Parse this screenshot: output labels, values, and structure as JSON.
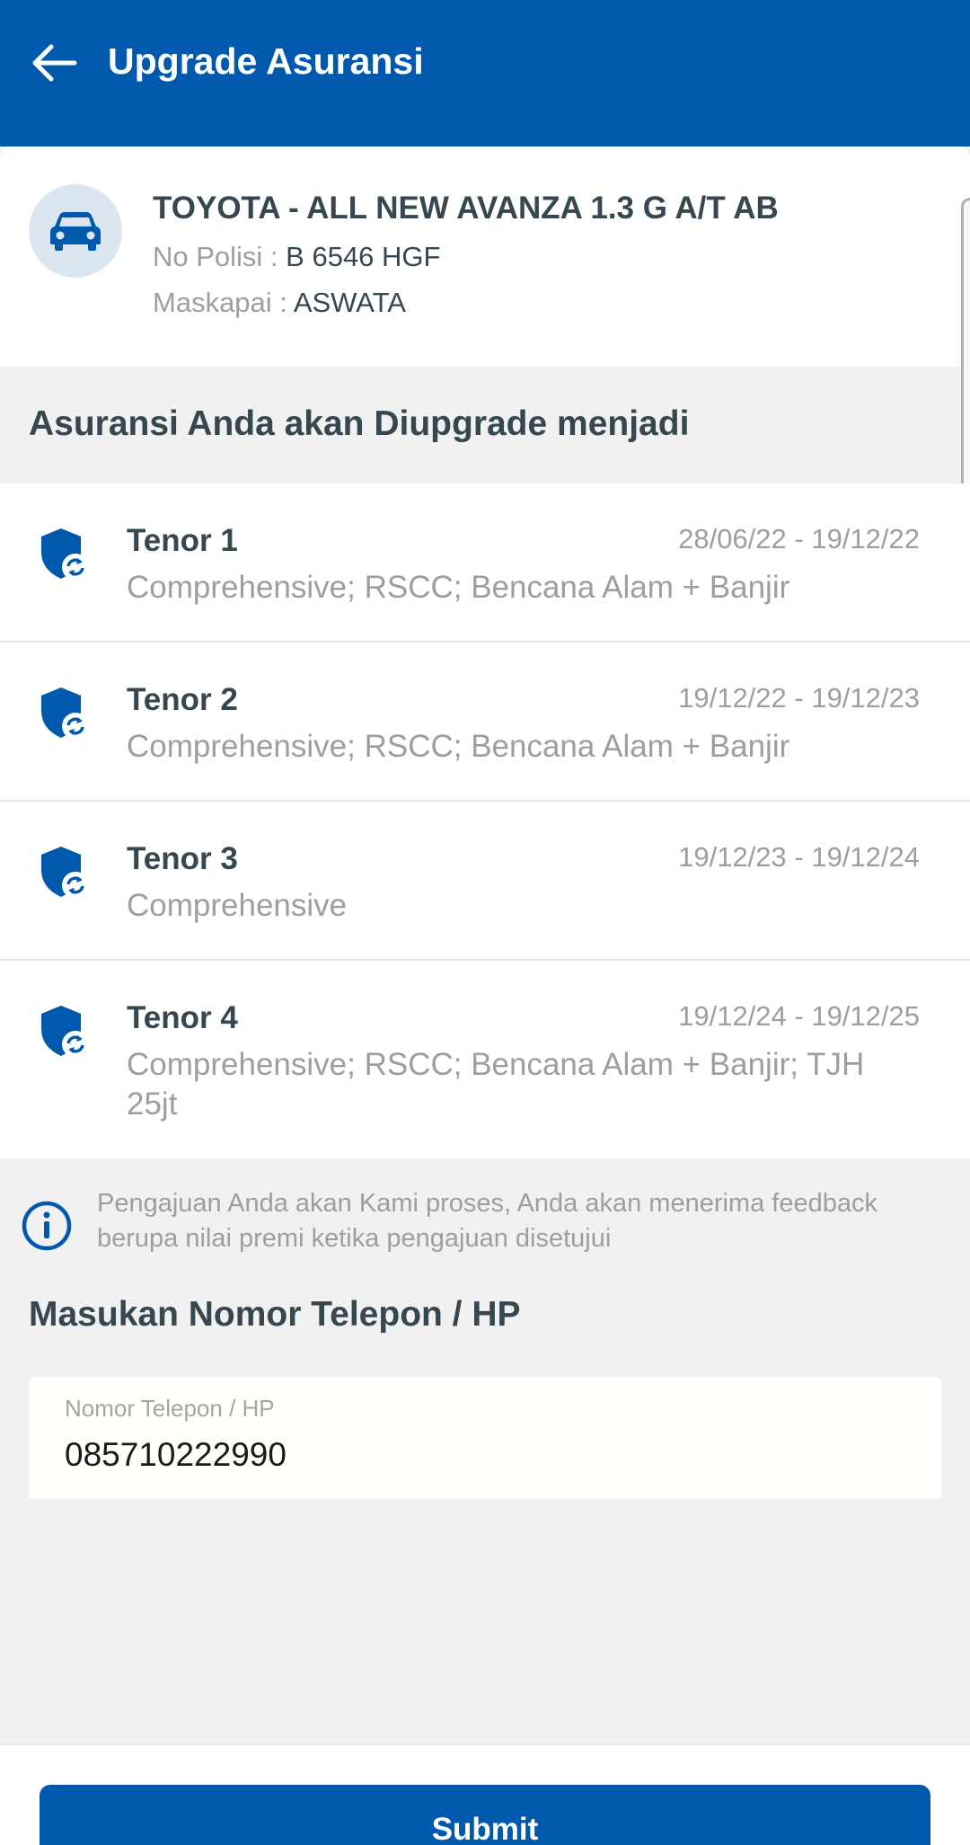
{
  "header": {
    "title": "Upgrade Asuransi",
    "back_icon": "arrow-left-icon"
  },
  "vehicle": {
    "name": "TOYOTA - ALL NEW AVANZA 1.3 G A/T AB",
    "police_label": "No Polisi : ",
    "police_value": "B 6546 HGF",
    "insurer_label": "Maskapai : ",
    "insurer_value": "ASWATA",
    "icon": "car-icon"
  },
  "section_title": "Asuransi Anda akan Diupgrade menjadi",
  "tenors": [
    {
      "name": "Tenor 1",
      "date": "28/06/22 - 19/12/22",
      "coverage": "Comprehensive; RSCC; Bencana Alam + Banjir"
    },
    {
      "name": "Tenor 2",
      "date": "19/12/22 - 19/12/23",
      "coverage": "Comprehensive; RSCC; Bencana Alam + Banjir"
    },
    {
      "name": "Tenor 3",
      "date": "19/12/23 - 19/12/24",
      "coverage": "Comprehensive"
    },
    {
      "name": "Tenor 4",
      "date": "19/12/24 - 19/12/25",
      "coverage": "Comprehensive; RSCC; Bencana Alam + Banjir; TJH 25jt"
    }
  ],
  "info": {
    "text": "Pengajuan Anda akan Kami proses, Anda akan menerima feedback berupa nilai premi ketika pengajuan disetujui",
    "icon": "info-icon"
  },
  "phone": {
    "title": "Masukan Nomor Telepon / HP",
    "label": "Nomor Telepon / HP",
    "value": "085710222990"
  },
  "submit_label": "Submit",
  "colors": {
    "primary": "#0059ad",
    "background": "#f1f1f1",
    "text_dark": "#37474f",
    "text_muted": "#9e9e9e"
  }
}
